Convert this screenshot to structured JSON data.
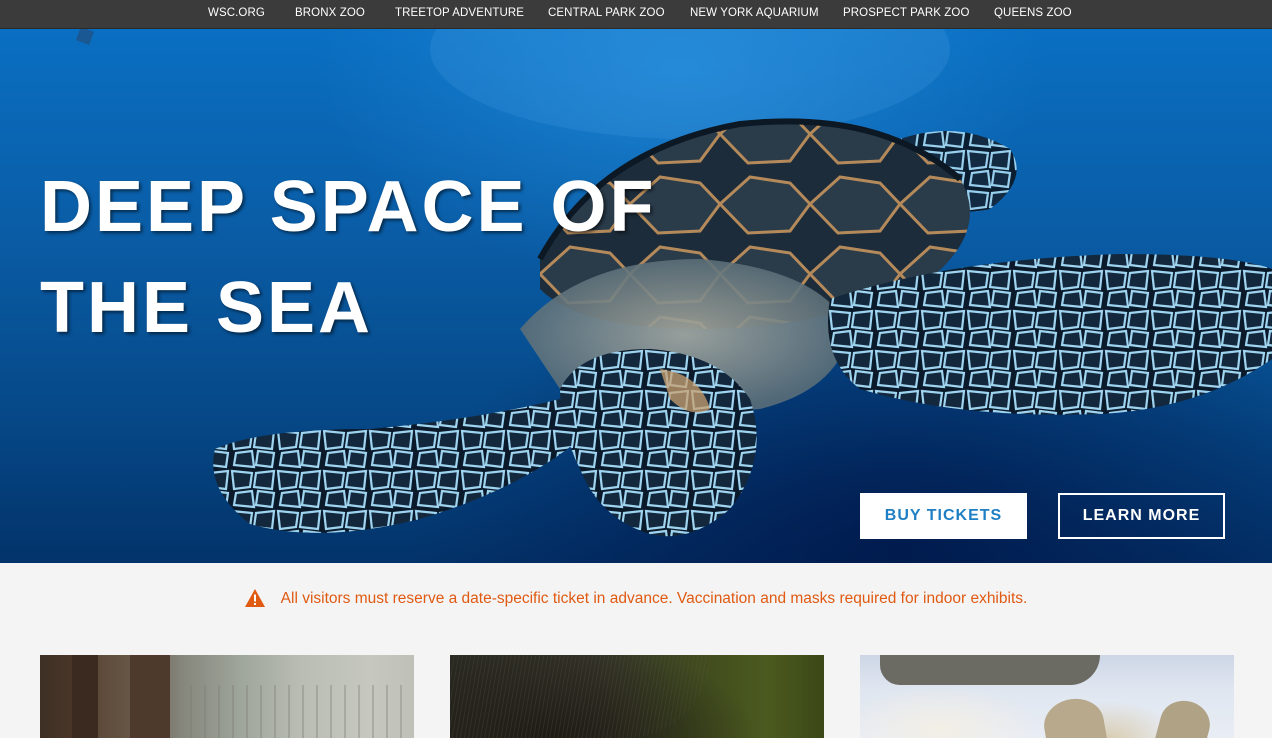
{
  "topnav": {
    "links": [
      {
        "label": "WSC.ORG"
      },
      {
        "label": "BRONX ZOO"
      },
      {
        "label": "TREETOP ADVENTURE"
      },
      {
        "label": "CENTRAL PARK ZOO"
      },
      {
        "label": "NEW YORK AQUARIUM"
      },
      {
        "label": "PROSPECT PARK ZOO"
      },
      {
        "label": "QUEENS ZOO"
      }
    ]
  },
  "hero": {
    "title_line1": "DEEP SPACE OF",
    "title_line2": "THE SEA",
    "image": "sea-turtle-photo",
    "buy_label": "BUY TICKETS",
    "learn_label": "LEARN MORE"
  },
  "alert": {
    "icon": "warning-icon",
    "text": "All visitors must reserve a date-specific ticket in advance. Vaccination and masks required for indoor exhibits.",
    "color": "#e05a12"
  },
  "cards": [
    {
      "image": "animal-photo-forest"
    },
    {
      "image": "animal-photo-fur-closeup"
    },
    {
      "image": "animal-photo-snow"
    }
  ],
  "colors": {
    "nav_bg": "#3b3b3b",
    "accent": "#1f7fc4",
    "page_bg": "#f4f4f4"
  }
}
